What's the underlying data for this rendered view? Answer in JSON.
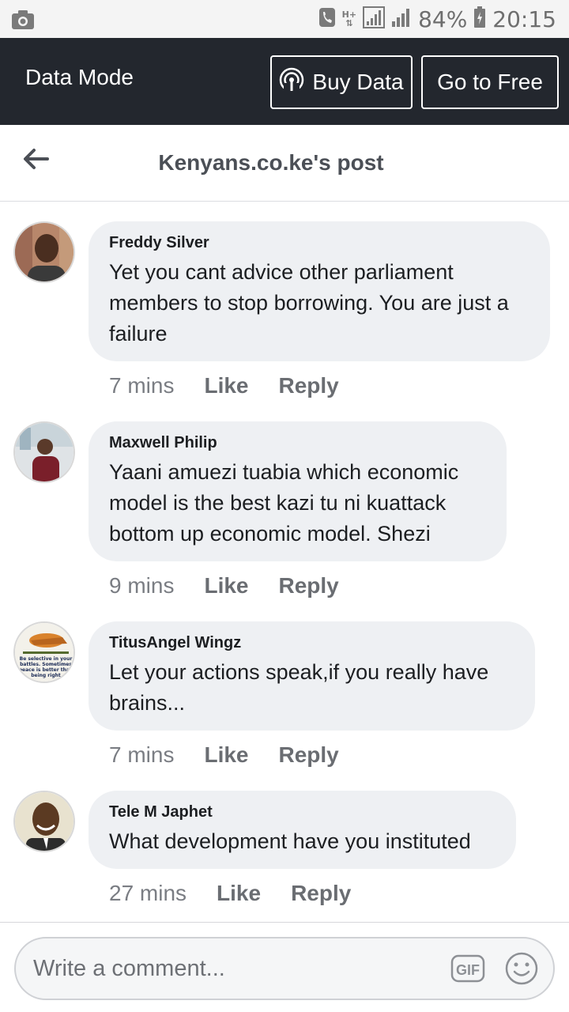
{
  "status_bar": {
    "battery": "84%",
    "time": "20:15",
    "network": "H+"
  },
  "banner": {
    "mode_label": "Data Mode",
    "buy_data_label": "Buy Data",
    "go_free_label": "Go to Free"
  },
  "header": {
    "title": "Kenyans.co.ke's post"
  },
  "comments": [
    {
      "author": "Freddy Silver",
      "text": "Yet you cant advice other parliament members to stop borrowing.  You are just a failure",
      "time": "7 mins",
      "like_label": "Like",
      "reply_label": "Reply"
    },
    {
      "author": "Maxwell Philip",
      "text": "Yaani amuezi tuabia which economic model is the best kazi tu ni kuattack bottom up economic model. Shezi",
      "time": "9 mins",
      "like_label": "Like",
      "reply_label": "Reply"
    },
    {
      "author": "TitusAngel Wingz",
      "text": "Let your actions speak,if you really have brains...",
      "time": "7 mins",
      "like_label": "Like",
      "reply_label": "Reply",
      "avatar_caption": "Be selective in your battles. Sometimes peace is better than being right"
    },
    {
      "author": "Tele M Japhet",
      "text": "What development have you instituted",
      "time": "27 mins",
      "like_label": "Like",
      "reply_label": "Reply"
    }
  ],
  "composer": {
    "placeholder": "Write a comment...",
    "gif_label": "GIF"
  }
}
